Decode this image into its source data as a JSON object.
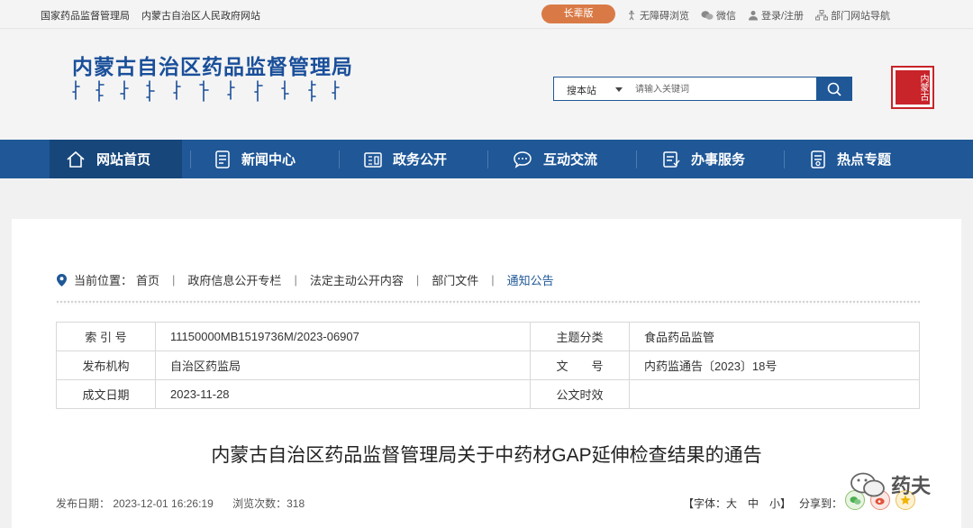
{
  "topbar": {
    "links_left": [
      "国家药品监督管理局",
      "内蒙古自治区人民政府网站"
    ],
    "elder_button": "长辈版",
    "links_right": [
      {
        "label": "无障碍浏览",
        "icon": "accessibility-icon"
      },
      {
        "label": "微信",
        "icon": "wechat-icon"
      },
      {
        "label": "登录/注册",
        "icon": "user-icon"
      },
      {
        "label": "部门网站导航",
        "icon": "sitemap-icon"
      }
    ]
  },
  "header": {
    "site_title": "内蒙古自治区药品监督管理局",
    "search": {
      "scope": "搜本站",
      "placeholder": "请输入关键词"
    },
    "seal_text": "内蒙古"
  },
  "nav": {
    "items": [
      {
        "label": "网站首页",
        "icon": "home-icon",
        "active": true
      },
      {
        "label": "新闻中心",
        "icon": "news-icon"
      },
      {
        "label": "政务公开",
        "icon": "gov-affairs-icon"
      },
      {
        "label": "互动交流",
        "icon": "chat-icon"
      },
      {
        "label": "办事服务",
        "icon": "service-icon"
      },
      {
        "label": "热点专题",
        "icon": "topic-icon"
      }
    ]
  },
  "breadcrumb": {
    "prefix": "当前位置：",
    "items": [
      "首页",
      "政府信息公开专栏",
      "法定主动公开内容",
      "部门文件",
      "通知公告"
    ]
  },
  "meta": {
    "rows": [
      [
        "索 引 号",
        "11150000MB1519736M/2023-06907",
        "主题分类",
        "食品药品监管"
      ],
      [
        "发布机构",
        "自治区药监局",
        "文　　号",
        "内药监通告〔2023〕18号"
      ],
      [
        "成文日期",
        "2023-11-28",
        "公文时效",
        ""
      ]
    ]
  },
  "article": {
    "title": "内蒙古自治区药品监督管理局关于中药材GAP延伸检查结果的通告",
    "publish_date": "发布日期： 2023-12-01 16:26:19",
    "views": "浏览次数：318",
    "font_size": "【字体：大　中　小】",
    "share": "分享到："
  },
  "watermark": "药夫",
  "colors": {
    "nav_blue": "#1f5797",
    "elder_orange": "#d97a46",
    "seal_red": "#c8242a"
  }
}
